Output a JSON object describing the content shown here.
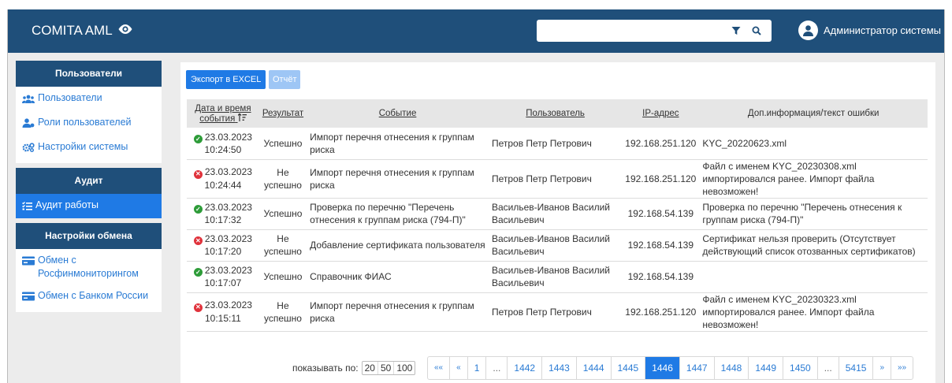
{
  "header": {
    "brand": "COMITA AML",
    "search_value": "",
    "user_name": "Администратор системы"
  },
  "sidebar": {
    "groups": [
      {
        "title": "Пользователи",
        "items": [
          {
            "label": "Пользователи",
            "icon": "users-icon"
          },
          {
            "label": "Роли пользователей",
            "icon": "user-roles-icon"
          },
          {
            "label": "Настройки системы",
            "icon": "gears-icon"
          }
        ]
      },
      {
        "title": "Аудит",
        "items": [
          {
            "label": "Аудит работы",
            "icon": "list-check-icon",
            "active": true
          }
        ]
      },
      {
        "title": "Настройки обмена",
        "items": [
          {
            "label": "Обмен с Росфинмониторингом",
            "icon": "card-icon"
          },
          {
            "label": "Обмен с Банком России",
            "icon": "card-icon"
          }
        ]
      }
    ]
  },
  "toolbar": {
    "excel_label": "Экспорт в EXCEL",
    "report_label": "Отчёт"
  },
  "table": {
    "headers": {
      "date": "Дата и время события",
      "result": "Результат",
      "event": "Событие",
      "user": "Пользователь",
      "ip": "IP-адрес",
      "info": "Доп.информация/текст ошибки"
    },
    "rows": [
      {
        "status": "ok",
        "date": "23.03.2023",
        "time": "10:24:50",
        "result": "Успешно",
        "event": "Импорт перечня отнесения к группам риска",
        "user": "Петров Петр Петрович",
        "ip": "192.168.251.120",
        "info": "KYC_20220623.xml"
      },
      {
        "status": "fail",
        "date": "23.03.2023",
        "time": "10:24:44",
        "result": "Не успешно",
        "event": "Импорт перечня отнесения к группам риска",
        "user": "Петров Петр Петрович",
        "ip": "192.168.251.120",
        "info": "Файл с именем KYC_20230308.xml импортировался ранее. Импорт файла невозможен!"
      },
      {
        "status": "ok",
        "date": "23.03.2023",
        "time": "10:17:32",
        "result": "Успешно",
        "event": "Проверка по перечню \"Перечень отнесения к группам риска (794-П)\"",
        "user": "Васильев-Иванов Василий Васильевич",
        "ip": "192.168.54.139",
        "info": "Проверка по перечню \"Перечень отнесения к группам риска (794-П)\""
      },
      {
        "status": "fail",
        "date": "23.03.2023",
        "time": "10:17:20",
        "result": "Не успешно",
        "event": "Добавление сертификата пользователя",
        "user": "Васильев-Иванов Василий Васильевич",
        "ip": "192.168.54.139",
        "info": "Сертификат нельзя проверить (Отсутствует действующий список отозванных сертификатов)"
      },
      {
        "status": "ok",
        "date": "23.03.2023",
        "time": "10:17:07",
        "result": "Успешно",
        "event": "Справочник ФИАС",
        "user": "Васильев-Иванов Василий Васильевич",
        "ip": "192.168.54.139",
        "info": ""
      },
      {
        "status": "fail",
        "date": "23.03.2023",
        "time": "10:15:11",
        "result": "Не успешно",
        "event": "Импорт перечня отнесения к группам риска",
        "user": "Петров Петр Петрович",
        "ip": "192.168.251.120",
        "info": "Файл с именем KYC_20230323.xml импортировался ранее. Импорт файла невозможен!"
      }
    ]
  },
  "pagination": {
    "per_page_label": "показывать по:",
    "per_page_options": [
      "20",
      "50",
      "100"
    ],
    "pages": [
      "««",
      "«",
      "1",
      "...",
      "1442",
      "1443",
      "1444",
      "1445",
      "1446",
      "1447",
      "1448",
      "1449",
      "1450",
      "...",
      "5415",
      "»",
      "»»"
    ],
    "current_page": "1446"
  },
  "colors": {
    "topbar": "#1f4f7a",
    "accent": "#1f7ae5",
    "link": "#2a7bd4",
    "success": "#2e9c39",
    "error": "#e0323b"
  }
}
